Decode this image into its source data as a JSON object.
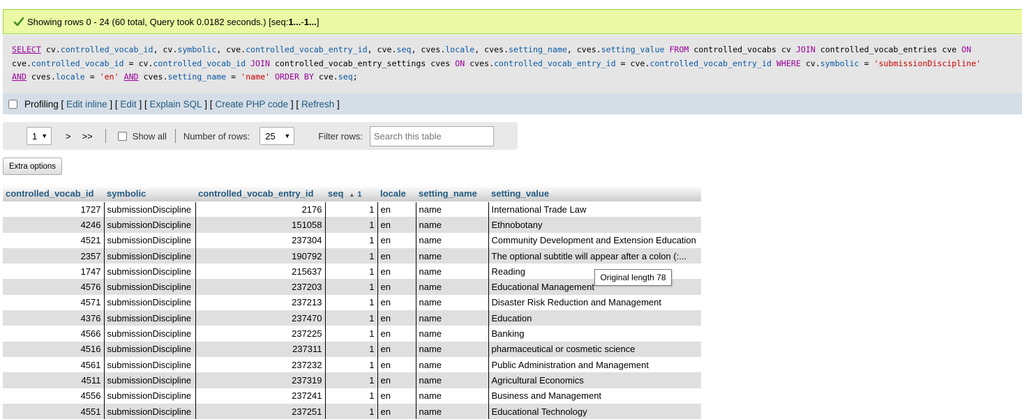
{
  "success": {
    "prefix": "Showing rows 0 - 24 (60 total, Query took 0.0182 seconds.) [seq: ",
    "from": "1...",
    "mid": " - ",
    "to": "1...",
    "suffix": "]"
  },
  "sql": {
    "line1": [
      {
        "t": "kwu",
        "v": "SELECT"
      },
      {
        "t": "sym",
        "v": " cv."
      },
      {
        "t": "fld",
        "v": "controlled_vocab_id"
      },
      {
        "t": "sym",
        "v": ", cv."
      },
      {
        "t": "fld",
        "v": "symbolic"
      },
      {
        "t": "sym",
        "v": ", cve."
      },
      {
        "t": "fld",
        "v": "controlled_vocab_entry_id"
      },
      {
        "t": "sym",
        "v": ", cve."
      },
      {
        "t": "fld",
        "v": "seq"
      },
      {
        "t": "sym",
        "v": ", cves."
      },
      {
        "t": "fld",
        "v": "locale"
      },
      {
        "t": "sym",
        "v": ", cves."
      },
      {
        "t": "fld",
        "v": "setting_name"
      },
      {
        "t": "sym",
        "v": ", cves."
      },
      {
        "t": "fld",
        "v": "setting_value"
      },
      {
        "t": "sym",
        "v": " "
      },
      {
        "t": "kw",
        "v": "FROM"
      },
      {
        "t": "sym",
        "v": " controlled_vocabs cv "
      },
      {
        "t": "kw",
        "v": "JOIN"
      },
      {
        "t": "sym",
        "v": " controlled_vocab_entries cve "
      },
      {
        "t": "kw",
        "v": "ON"
      }
    ],
    "line2": [
      {
        "t": "sym",
        "v": "cve."
      },
      {
        "t": "fld",
        "v": "controlled_vocab_id"
      },
      {
        "t": "sym",
        "v": " = cv."
      },
      {
        "t": "fld",
        "v": "controlled_vocab_id"
      },
      {
        "t": "sym",
        "v": " "
      },
      {
        "t": "kw",
        "v": "JOIN"
      },
      {
        "t": "sym",
        "v": " controlled_vocab_entry_settings cves "
      },
      {
        "t": "kw",
        "v": "ON"
      },
      {
        "t": "sym",
        "v": " cves."
      },
      {
        "t": "fld",
        "v": "controlled_vocab_entry_id"
      },
      {
        "t": "sym",
        "v": " = cve."
      },
      {
        "t": "fld",
        "v": "controlled_vocab_entry_id"
      },
      {
        "t": "sym",
        "v": " "
      },
      {
        "t": "kw",
        "v": "WHERE"
      },
      {
        "t": "sym",
        "v": " cv."
      },
      {
        "t": "fld",
        "v": "symbolic"
      },
      {
        "t": "sym",
        "v": " = "
      },
      {
        "t": "str",
        "v": "'submissionDiscipline'"
      }
    ],
    "line3": [
      {
        "t": "kwu",
        "v": "AND"
      },
      {
        "t": "sym",
        "v": " cves."
      },
      {
        "t": "fld",
        "v": "locale"
      },
      {
        "t": "sym",
        "v": " = "
      },
      {
        "t": "str",
        "v": "'en'"
      },
      {
        "t": "sym",
        "v": " "
      },
      {
        "t": "kwu",
        "v": "AND"
      },
      {
        "t": "sym",
        "v": " cves."
      },
      {
        "t": "fld",
        "v": "setting_name"
      },
      {
        "t": "sym",
        "v": " = "
      },
      {
        "t": "str",
        "v": "'name'"
      },
      {
        "t": "sym",
        "v": " "
      },
      {
        "t": "kw",
        "v": "ORDER BY"
      },
      {
        "t": "sym",
        "v": " cve."
      },
      {
        "t": "fld",
        "v": "seq"
      },
      {
        "t": "sym",
        "v": ";"
      }
    ]
  },
  "profiling": {
    "label": "Profiling",
    "links": [
      "Edit inline",
      "Edit",
      "Explain SQL",
      "Create PHP code",
      "Refresh"
    ]
  },
  "nav": {
    "page_value": "1",
    "next": ">",
    "last": ">>",
    "show_all": "Show all",
    "rows_label": "Number of rows:",
    "rows_value": "25",
    "filter_label": "Filter rows:",
    "filter_placeholder": "Search this table"
  },
  "extra_options": "Extra options",
  "tooltip": "Original length 78",
  "table": {
    "headers": [
      "controlled_vocab_id",
      "symbolic",
      "controlled_vocab_entry_id",
      "seq",
      "locale",
      "setting_name",
      "setting_value"
    ],
    "sort_indicator": "1",
    "rows": [
      [
        "1727",
        "submissionDiscipline",
        "2176",
        "1",
        "en",
        "name",
        "International Trade Law"
      ],
      [
        "4246",
        "submissionDiscipline",
        "151058",
        "1",
        "en",
        "name",
        "Ethnobotany"
      ],
      [
        "4521",
        "submissionDiscipline",
        "237304",
        "1",
        "en",
        "name",
        "Community Development and Extension Education"
      ],
      [
        "2357",
        "submissionDiscipline",
        "190792",
        "1",
        "en",
        "name",
        "The optional subtitle will appear after a colon (:..."
      ],
      [
        "1747",
        "submissionDiscipline",
        "215637",
        "1",
        "en",
        "name",
        "Reading"
      ],
      [
        "4576",
        "submissionDiscipline",
        "237203",
        "1",
        "en",
        "name",
        "Educational Management"
      ],
      [
        "4571",
        "submissionDiscipline",
        "237213",
        "1",
        "en",
        "name",
        "Disaster Risk Reduction and Management"
      ],
      [
        "4376",
        "submissionDiscipline",
        "237470",
        "1",
        "en",
        "name",
        "Education"
      ],
      [
        "4566",
        "submissionDiscipline",
        "237225",
        "1",
        "en",
        "name",
        "Banking"
      ],
      [
        "4516",
        "submissionDiscipline",
        "237311",
        "1",
        "en",
        "name",
        "pharmaceutical or cosmetic science"
      ],
      [
        "4561",
        "submissionDiscipline",
        "237232",
        "1",
        "en",
        "name",
        "Public Administration and Management"
      ],
      [
        "4511",
        "submissionDiscipline",
        "237319",
        "1",
        "en",
        "name",
        "Agricultural Economics"
      ],
      [
        "4556",
        "submissionDiscipline",
        "237241",
        "1",
        "en",
        "name",
        "Business and Management"
      ],
      [
        "4551",
        "submissionDiscipline",
        "237251",
        "1",
        "en",
        "name",
        "Educational Technology"
      ]
    ],
    "highlight_row": 3
  },
  "colors": {
    "success_bg": "#ebf8a4",
    "link": "#235a81",
    "keyword": "#990099",
    "string": "#cc0000"
  }
}
